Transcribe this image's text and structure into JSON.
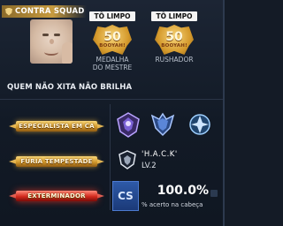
{
  "header": {
    "squad_label": "CONTRA SQUAD"
  },
  "medals": [
    {
      "badge": "TÔ LIMPO",
      "number": "50",
      "sub": "BOOYAH!",
      "label_line1": "MEDALHA",
      "label_line2": "DO MESTRE"
    },
    {
      "badge": "TÔ LIMPO",
      "number": "50",
      "sub": "BOOYAH!",
      "label_line1": "RUSHADOR",
      "label_line2": ""
    }
  ],
  "section": {
    "title": "QUEM NÃO XITA NÃO BRILHA"
  },
  "banners": [
    {
      "text": "ESPECIALISTA EM CA",
      "style": "gold"
    },
    {
      "text": "FÚRIA TEMPESTADE",
      "style": "gold"
    },
    {
      "text": "EXTERMINADOR",
      "style": "red"
    }
  ],
  "emblems": [
    "skull-wings-emblem",
    "wolf-emblem",
    "crest-emblem"
  ],
  "player": {
    "name": "'H.A.C.K'",
    "level": "LV.2"
  },
  "stat": {
    "icon_text": "CS",
    "value": "100.0%",
    "label": "% acerto na cabeça"
  },
  "colors": {
    "gold": "#d59a2c",
    "red": "#d22a1e",
    "blue": "#2e5aa8",
    "bg": "#141b26"
  }
}
